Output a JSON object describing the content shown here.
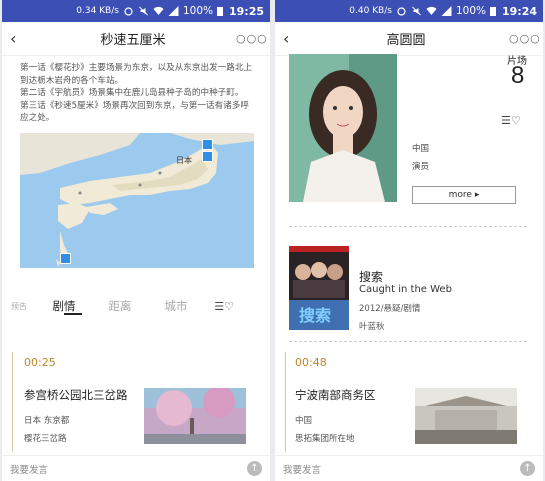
{
  "left": {
    "status": {
      "speed": "0.34 KB/s",
      "battery": "100%",
      "time": "19:25"
    },
    "title": "秒速五厘米",
    "description": [
      "第一话《樱花抄》主要场景为东京，以及从东京出发一路北上到达栃木岩舟的各个车站。",
      "第二话《宇航员》场景集中在鹿儿岛县种子岛的中种子町。",
      "第三话《秒速5厘米》场景再次回到东京，与第一话有诸多呼应之处。"
    ],
    "map_label": "日本",
    "side_label": "预告",
    "tabs": [
      "剧情",
      "距离",
      "城市"
    ],
    "card": {
      "time": "00:25",
      "title": "参宫桥公园北三岔路",
      "location": "日本 东京都",
      "note": "樱花三岔路"
    },
    "input_placeholder": "我要发言"
  },
  "right": {
    "status": {
      "speed": "0.40 KB/s",
      "battery": "100%",
      "time": "19:24"
    },
    "title": "高圆圆",
    "scene_label": "片场",
    "scene_count": "8",
    "country": "中国",
    "role": "演员",
    "more_label": "more ▸",
    "movie": {
      "title": "搜索",
      "english": "Caught in the Web",
      "meta": "2012/悬疑/剧情",
      "director": "叶蓝秋",
      "poster_text": "搜索"
    },
    "card": {
      "time": "00:48",
      "title": "宁波南部商务区",
      "location": "中国",
      "note": "思拓集团所在地"
    },
    "input_placeholder": "我要发言"
  },
  "colors": {
    "statusbar": "#3b4fb5",
    "accent_time": "#b8862b"
  }
}
